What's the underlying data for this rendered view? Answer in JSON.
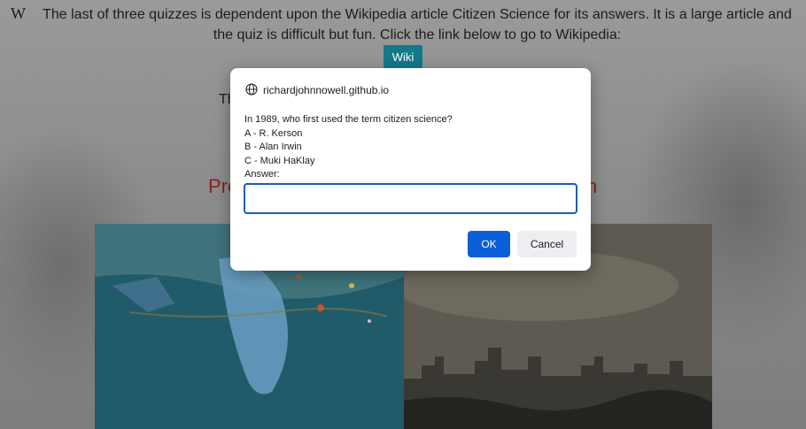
{
  "page": {
    "wiki_glyph": "W",
    "intro_text": "The last of three quizzes is dependent upon the Wikipedia article Citizen Science for its answers. It is a large article and the quiz is difficult but fun. Click the link below to go to Wikipedia:",
    "wiki_button_label": "Wiki",
    "partial_text": "Th",
    "heading_partial_left": "Pro",
    "heading_partial_right": "n",
    "heading_color": "#8b1f1f"
  },
  "dialog": {
    "origin": "richardjohnnowell.github.io",
    "prompt_lines": [
      "In 1989, who first used the term citizen science?",
      "A - R. Kerson",
      "B - Alan Irwin",
      "C - Muki HaKlay",
      "Answer:"
    ],
    "input_value": "",
    "ok_label": "OK",
    "cancel_label": "Cancel",
    "accent_color": "#0b5fd8"
  },
  "icons": {
    "origin": "globe-icon",
    "wiki": "wikipedia-w-icon"
  }
}
